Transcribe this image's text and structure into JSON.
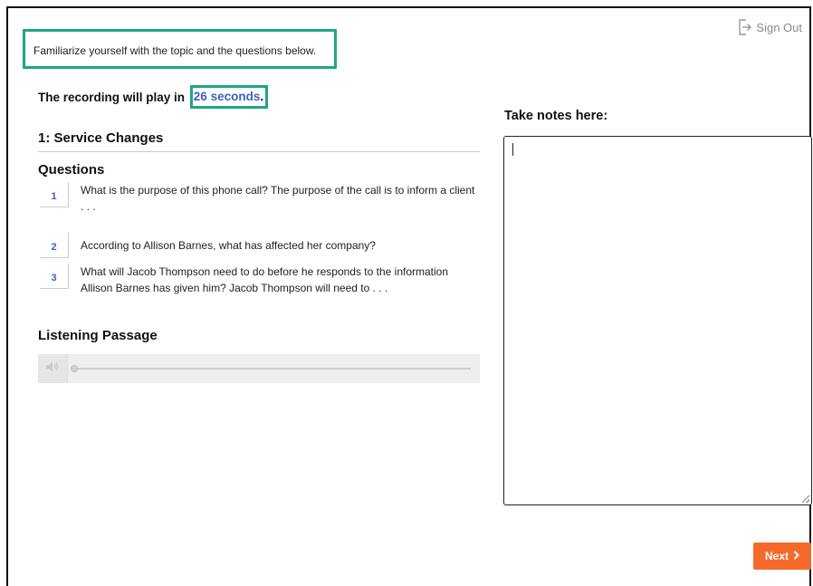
{
  "header": {
    "sign_out_label": "Sign Out",
    "sign_out_icon": "sign-out-icon"
  },
  "instruction": {
    "text": "Familiarize yourself with the topic and the questions below."
  },
  "timer": {
    "prefix": "The recording will play in",
    "value": "26 seconds",
    "suffix": "."
  },
  "notes": {
    "label": "Take notes here:",
    "value": ""
  },
  "section": {
    "title": "1: Service Changes"
  },
  "questions": {
    "heading": "Questions",
    "items": [
      {
        "number": "1",
        "text": "What is the purpose of this phone call? The purpose of the call is to inform a client . . ."
      },
      {
        "number": "2",
        "text": "According to Allison Barnes, what has affected her company?"
      },
      {
        "number": "3",
        "text": "What will Jacob Thompson need to do before he responds to the information Allison Barnes has given him? Jacob Thompson will need to . . ."
      }
    ]
  },
  "listening": {
    "heading": "Listening Passage",
    "volume_icon": "volume-icon",
    "progress": 0
  },
  "footer": {
    "next_label": "Next",
    "next_icon": "chevron-right-icon"
  },
  "colors": {
    "highlight_border": "#1fa585",
    "link_blue": "#3a5fc8",
    "next_button": "#f56a2c"
  }
}
